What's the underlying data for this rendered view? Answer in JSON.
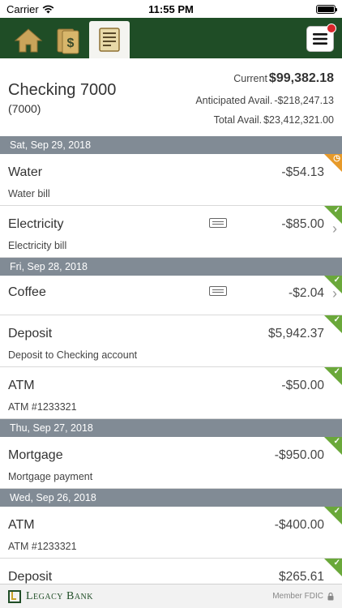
{
  "status": {
    "carrier": "Carrier",
    "time": "11:55 PM"
  },
  "nav": {
    "tabs": [
      {
        "name": "home",
        "icon": "home-icon"
      },
      {
        "name": "transfers",
        "icon": "money-icon"
      },
      {
        "name": "register",
        "icon": "ledger-icon"
      }
    ],
    "menu_icon": "hamburger-icon"
  },
  "account": {
    "name": "Checking 7000",
    "number": "(7000)",
    "current_label": "Current",
    "current_value": "$99,382.18",
    "anticipated_label": "Anticipated Avail.",
    "anticipated_value": "-$218,247.13",
    "total_label": "Total Avail.",
    "total_value": "$23,412,321.00"
  },
  "groups": [
    {
      "date": "Sat, Sep 29, 2018",
      "items": [
        {
          "name": "Water",
          "desc": "Water bill",
          "amount": "-$54.13",
          "status": "pending"
        },
        {
          "name": "Electricity",
          "desc": "Electricity bill",
          "amount": "-$85.00",
          "status": "cleared",
          "memo": true,
          "chevron": true
        }
      ]
    },
    {
      "date": "Fri, Sep 28, 2018",
      "items": [
        {
          "name": "Coffee",
          "desc": "",
          "amount": "-$2.04",
          "status": "cleared",
          "memo": true,
          "chevron": true
        },
        {
          "name": "Deposit",
          "desc": "Deposit to Checking account",
          "amount": "$5,942.37",
          "status": "cleared"
        },
        {
          "name": "ATM",
          "desc": "ATM #1233321",
          "amount": "-$50.00",
          "status": "cleared"
        }
      ]
    },
    {
      "date": "Thu, Sep 27, 2018",
      "items": [
        {
          "name": "Mortgage",
          "desc": "Mortgage payment",
          "amount": "-$950.00",
          "status": "cleared"
        }
      ]
    },
    {
      "date": "Wed, Sep 26, 2018",
      "items": [
        {
          "name": "ATM",
          "desc": "ATM #1233321",
          "amount": "-$400.00",
          "status": "cleared"
        },
        {
          "name": "Deposit",
          "desc": "",
          "amount": "$265.61",
          "status": "cleared"
        }
      ]
    }
  ],
  "footer": {
    "bank_name": "Legacy Bank",
    "fdic": "Member FDIC"
  },
  "colors": {
    "nav": "#1f4d26",
    "date_header": "#818b95",
    "cleared": "#6aa83a",
    "pending": "#e79a2a",
    "badge": "#d9252a"
  }
}
